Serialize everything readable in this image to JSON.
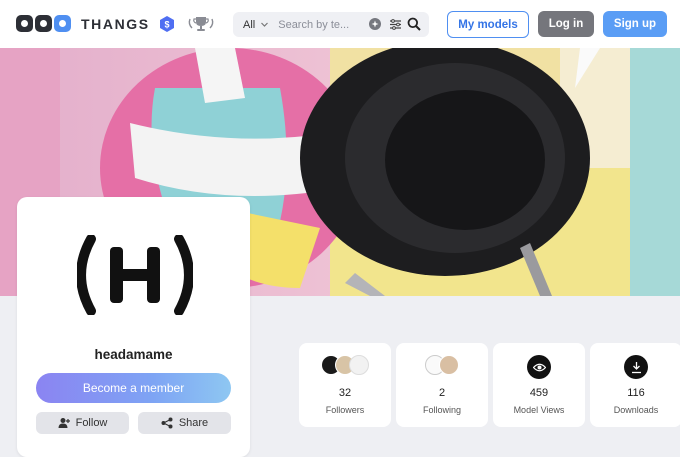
{
  "header": {
    "brand": "THANGS",
    "search": {
      "category": "All",
      "placeholder": "Search by te..."
    },
    "my_models": "My models",
    "login": "Log in",
    "signup": "Sign up"
  },
  "profile": {
    "avatar_text": "(H)",
    "username": "headamame",
    "member_button": "Become a member",
    "follow_button": "Follow",
    "share_button": "Share"
  },
  "stats": [
    {
      "value": "32",
      "label": "Followers"
    },
    {
      "value": "2",
      "label": "Following"
    },
    {
      "value": "459",
      "label": "Model Views"
    },
    {
      "value": "116",
      "label": "Downloads"
    }
  ]
}
